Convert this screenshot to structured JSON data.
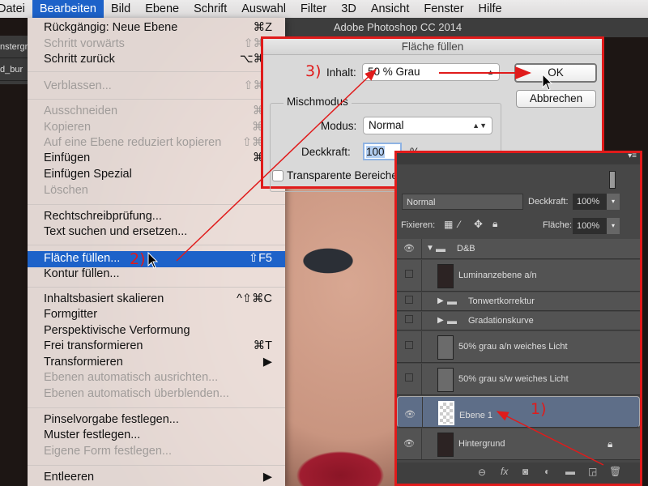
{
  "menubar": {
    "items": [
      "Datei",
      "Bearbeiten",
      "Bild",
      "Ebene",
      "Schrift",
      "Auswahl",
      "Filter",
      "3D",
      "Ansicht",
      "Fenster",
      "Hilfe"
    ],
    "active": "Bearbeiten"
  },
  "app_title": "Adobe Photoshop CC 2014",
  "doc_tabs": [
    "nstergr",
    "d_bur"
  ],
  "edit_menu": [
    {
      "label": "Rückgängig: Neue Ebene",
      "shortcut": "⌘Z",
      "enabled": true
    },
    {
      "label": "Schritt vorwärts",
      "shortcut": "⇧⌘Z",
      "enabled": false
    },
    {
      "label": "Schritt zurück",
      "shortcut": "⌥⌘Z",
      "enabled": true
    },
    {
      "label": "Verblassen...",
      "shortcut": "⇧⌘F",
      "enabled": false
    },
    {
      "label": "Ausschneiden",
      "shortcut": "⌘X",
      "enabled": false
    },
    {
      "label": "Kopieren",
      "shortcut": "⌘C",
      "enabled": false
    },
    {
      "label": "Auf eine Ebene reduziert kopieren",
      "shortcut": "⇧⌘C",
      "enabled": false
    },
    {
      "label": "Einfügen",
      "shortcut": "⌘V",
      "enabled": true
    },
    {
      "label": "Einfügen Spezial",
      "shortcut": "",
      "enabled": true
    },
    {
      "label": "Löschen",
      "shortcut": "",
      "enabled": false
    },
    {
      "label": "Rechtschreibprüfung...",
      "shortcut": "",
      "enabled": true
    },
    {
      "label": "Text suchen und ersetzen...",
      "shortcut": "",
      "enabled": true
    },
    {
      "label": "Fläche füllen...",
      "shortcut": "⇧F5",
      "enabled": true,
      "highlighted": true
    },
    {
      "label": "Kontur füllen...",
      "shortcut": "",
      "enabled": true
    },
    {
      "label": "Inhaltsbasiert skalieren",
      "shortcut": "^⇧⌘C",
      "enabled": true
    },
    {
      "label": "Formgitter",
      "shortcut": "",
      "enabled": true
    },
    {
      "label": "Perspektivische Verformung",
      "shortcut": "",
      "enabled": true
    },
    {
      "label": "Frei transformieren",
      "shortcut": "⌘T",
      "enabled": true
    },
    {
      "label": "Transformieren",
      "shortcut": "▶",
      "enabled": true
    },
    {
      "label": "Ebenen automatisch ausrichten...",
      "shortcut": "",
      "enabled": false
    },
    {
      "label": "Ebenen automatisch überblenden...",
      "shortcut": "",
      "enabled": false
    },
    {
      "label": "Pinselvorgabe festlegen...",
      "shortcut": "",
      "enabled": true
    },
    {
      "label": "Muster festlegen...",
      "shortcut": "",
      "enabled": true
    },
    {
      "label": "Eigene Form festlegen...",
      "shortcut": "",
      "enabled": false
    },
    {
      "label": "Entleeren",
      "shortcut": "▶",
      "enabled": true
    }
  ],
  "dialog": {
    "title": "Fläche füllen",
    "inhalt_label": "Inhalt:",
    "inhalt_value": "50 % Grau",
    "ok": "OK",
    "cancel": "Abbrechen",
    "group_title": "Mischmodus",
    "modus_label": "Modus:",
    "modus_value": "Normal",
    "deckkraft_label": "Deckkraft:",
    "deckkraft_value": "100",
    "percent": "%",
    "preserve_label": "Transparente Bereiche schützen",
    "preserve_checked": false
  },
  "layers_panel": {
    "blend_mode": "Normal",
    "opacity_label": "Deckkraft:",
    "opacity": "100%",
    "lock_label": "Fixieren:",
    "fill_label": "Fläche:",
    "fill": "100%",
    "layers": [
      {
        "name": "D&B",
        "type": "group",
        "expanded": true,
        "visible": true
      },
      {
        "name": "Luminanzebene a/n",
        "type": "layer",
        "visible": false
      },
      {
        "name": "Tonwertkorrektur",
        "type": "group",
        "visible": false
      },
      {
        "name": "Gradationskurve",
        "type": "group",
        "visible": false
      },
      {
        "name": "50% grau a/n weiches Licht",
        "type": "layer",
        "visible": false
      },
      {
        "name": "50% grau s/w weiches Licht",
        "type": "layer",
        "visible": false
      },
      {
        "name": "Ebene 1",
        "type": "layer",
        "visible": true,
        "selected": true
      },
      {
        "name": "Hintergrund",
        "type": "layer",
        "visible": true,
        "locked": true
      }
    ]
  },
  "annotations": [
    "1)",
    "2)",
    "3)"
  ],
  "colors": {
    "annotation": "#e01b1b",
    "menu_highlight": "#1d62c9",
    "selected_layer": "#5e6e88"
  }
}
